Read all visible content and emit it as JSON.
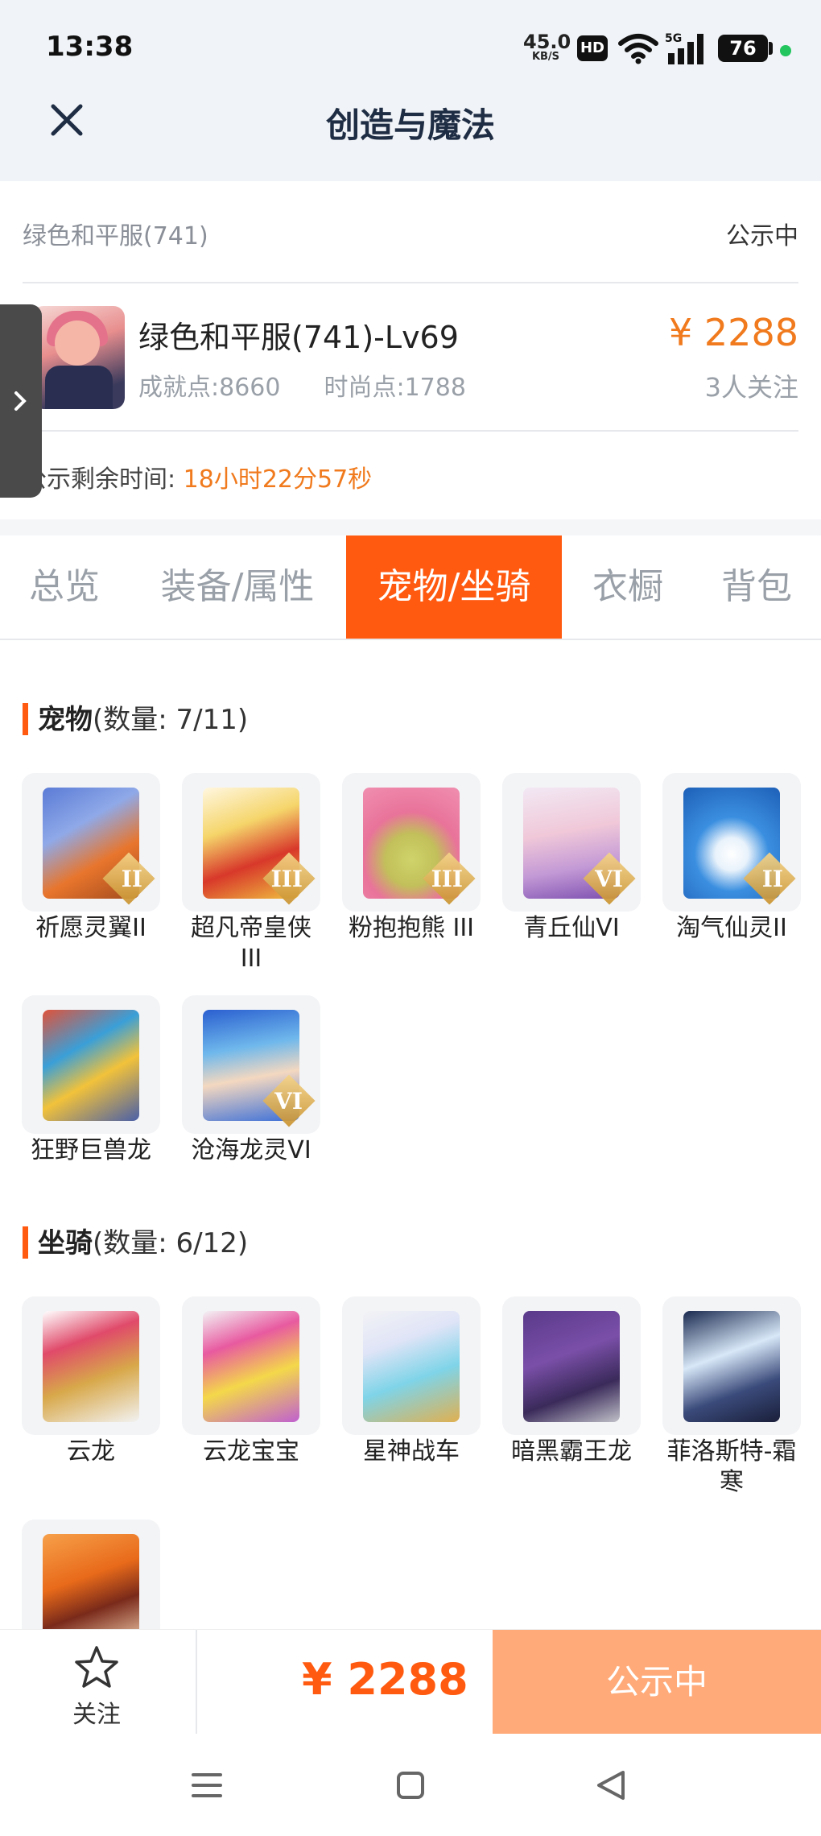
{
  "status_bar": {
    "time": "13:38",
    "net_speed": "45.0",
    "net_unit": "KB/S",
    "hd": "HD",
    "battery": "76"
  },
  "header": {
    "title": "创造与魔法"
  },
  "summary": {
    "server": "绿色和平服(741)",
    "status": "公示中",
    "character_name": "绿色和平服(741)-Lv69",
    "achievement": "成就点:8660",
    "fashion": "时尚点:1788",
    "price": "¥ 2288",
    "followers": "3人关注",
    "remaining_label": "公示剩余时间:",
    "remaining_time": "18小时22分57秒"
  },
  "tabs": [
    {
      "label": "总览"
    },
    {
      "label": "装备/属性"
    },
    {
      "label": "宠物/坐骑"
    },
    {
      "label": "衣橱"
    },
    {
      "label": "背包"
    }
  ],
  "pets": {
    "title": "宠物",
    "count": "(数量: 7/11)",
    "items": [
      {
        "name": "祈愿灵翼II",
        "grade": "II"
      },
      {
        "name": "超凡帝皇侠III",
        "grade": "III"
      },
      {
        "name": "粉抱抱熊 III",
        "grade": "III"
      },
      {
        "name": "青丘仙VI",
        "grade": "VI"
      },
      {
        "name": "淘气仙灵II",
        "grade": "II"
      },
      {
        "name": "狂野巨兽龙",
        "grade": ""
      },
      {
        "name": "沧海龙灵VI",
        "grade": "VI"
      }
    ]
  },
  "mounts": {
    "title": "坐骑",
    "count": "(数量: 6/12)",
    "items": [
      {
        "name": "云龙"
      },
      {
        "name": "云龙宝宝"
      },
      {
        "name": "星神战车"
      },
      {
        "name": "暗黑霸王龙"
      },
      {
        "name": "菲洛斯特-霜寒"
      },
      {
        "name": ""
      }
    ]
  },
  "bottom_bar": {
    "follow_label": "关注",
    "price": "¥ 2288",
    "button": "公示中"
  },
  "colors": {
    "accent": "#ff5a10",
    "price": "#f07a1d",
    "button_disabled": "#ffaa78"
  }
}
